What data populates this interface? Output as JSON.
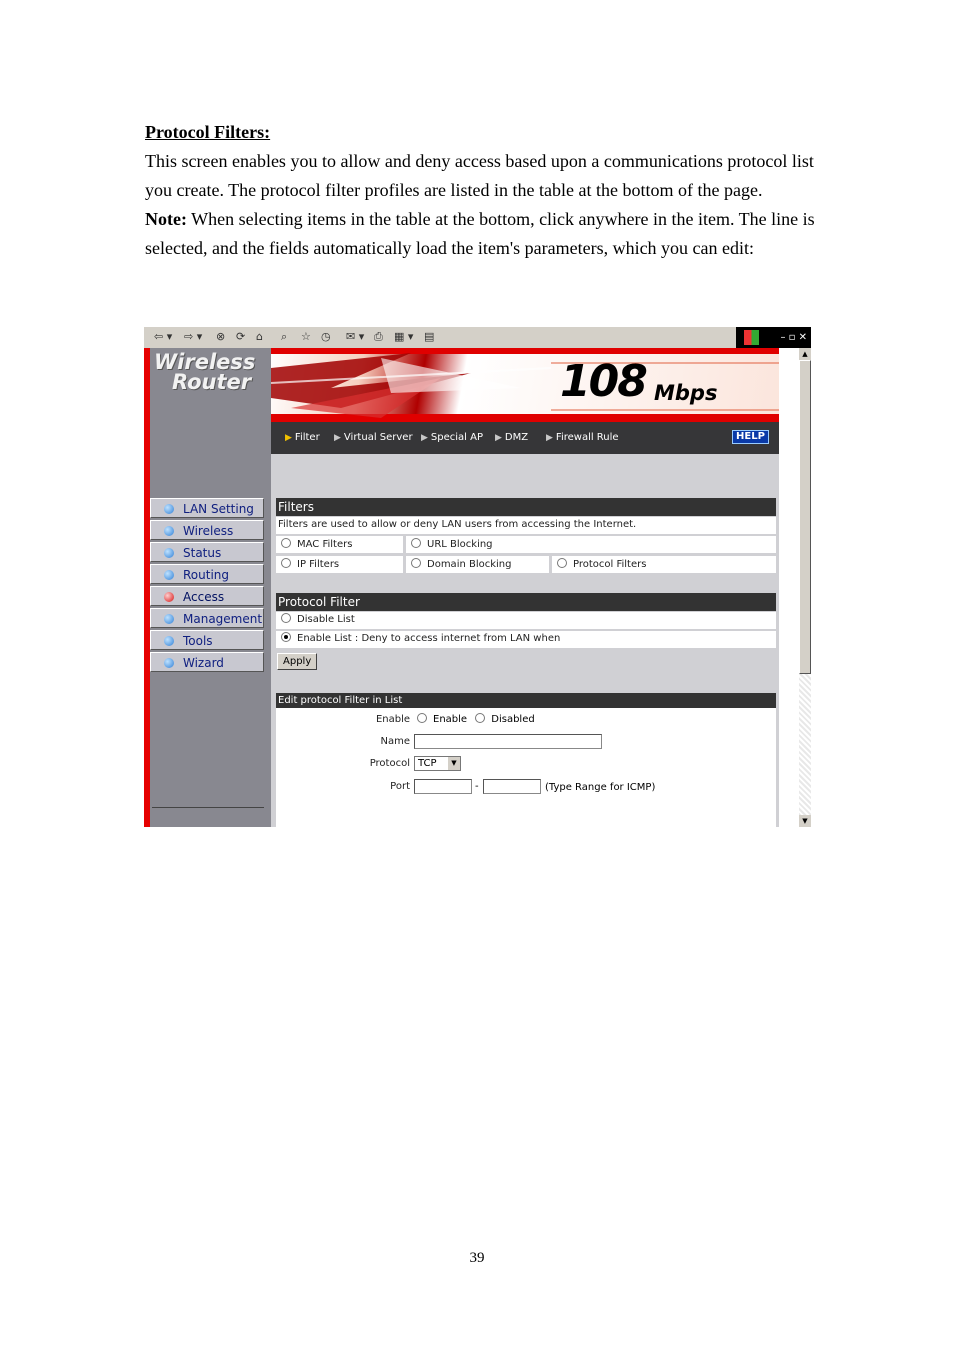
{
  "doc": {
    "heading": "Protocol Filters:",
    "para1": "This screen enables you to allow and deny access based upon a communications protocol list you create.    The protocol filter profiles are listed in the table at the bottom of the page.",
    "note_label": "Note:",
    "note_text": " When selecting items in the table at the bottom, click anywhere in the item. The line is selected, and the fields automatically load the item's parameters, which you can edit:",
    "page_number": "39"
  },
  "screenshot": {
    "brand_line1": "Wireless",
    "brand_line2": "Router",
    "speed_big": "108",
    "speed_unit": "Mbps",
    "nav": [
      "Filter",
      "Virtual Server",
      "Special AP",
      "DMZ",
      "Firewall Rule"
    ],
    "help": "HELP",
    "sidebar": [
      "LAN Setting",
      "Wireless",
      "Status",
      "Routing",
      "Access",
      "Management",
      "Tools",
      "Wizard"
    ],
    "active_sidebar": "Access",
    "filters": {
      "title": "Filters",
      "desc": "Filters are used to allow or deny LAN users from accessing the Internet.",
      "options": [
        "MAC Filters",
        "URL Blocking",
        "IP Filters",
        "Domain Blocking",
        "Protocol Filters"
      ],
      "selected": "Protocol Filters"
    },
    "protocol_filter": {
      "title": "Protocol Filter",
      "disable_label": "Disable List",
      "enable_label": "Enable List : ",
      "enable_text": "Deny to access internet from LAN when",
      "apply": "Apply"
    },
    "edit": {
      "title": "Edit protocol Filter in List",
      "enable_label": "Enable",
      "opt_enable": "Enable",
      "opt_disabled": "Disabled",
      "name_label": "Name",
      "name_value": "",
      "protocol_label": "Protocol",
      "protocol_value": "TCP",
      "port_label": "Port",
      "port_from": "",
      "port_to": "",
      "dash": "-",
      "port_hint": "(Type Range for ICMP)"
    }
  }
}
